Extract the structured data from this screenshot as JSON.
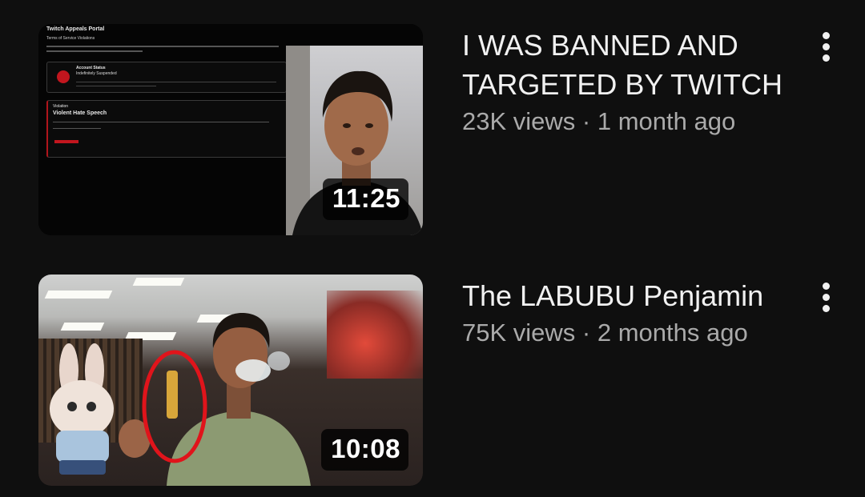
{
  "videos": [
    {
      "title": "I WAS BANNED AND TARGETED BY TWITCH",
      "views": "23K views",
      "age": "1 month ago",
      "separator": " · ",
      "duration": "11:25",
      "thumbnail": {
        "description": "Twitch Appeals Portal screenshot with streamer webcam",
        "header": "Twitch Appeals Portal",
        "subheader": "Terms of Service Violations",
        "status_title": "Account Status",
        "status_value": "Indefinitely Suspended",
        "violation_label": "Violation",
        "violation_title": "Violent Hate Speech"
      }
    },
    {
      "title": "The LABUBU Penjamin",
      "views": "75K views",
      "age": "2 months ago",
      "separator": " · ",
      "duration": "10:08",
      "thumbnail": {
        "description": "Man in music store holding vape with red circle and Labubu doll"
      }
    }
  ],
  "icons": {
    "more": "more-vert-icon"
  },
  "colors": {
    "background": "#0f0f0f",
    "title": "#f1f1f1",
    "meta": "#aaaaaa",
    "duration_bg": "#000000",
    "accent_red": "#c2161e"
  }
}
